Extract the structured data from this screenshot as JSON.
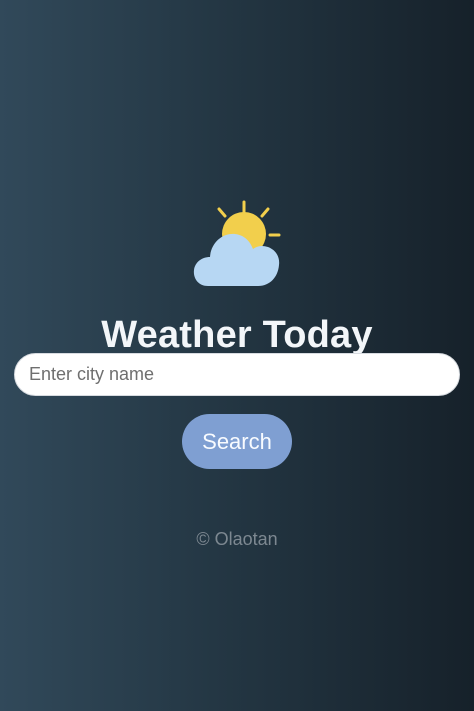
{
  "app": {
    "title": "Weather Today"
  },
  "search": {
    "placeholder": "Enter city name",
    "value": "",
    "button_label": "Search"
  },
  "footer": {
    "text": "© Olaotan"
  },
  "icons": {
    "weather": "partly-cloudy-icon"
  },
  "colors": {
    "background_start": "#31495a",
    "background_end": "#16212a",
    "sun": "#f2cf4c",
    "cloud": "#b7d7f3",
    "button": "#7f9fd2",
    "title": "#f3f6f9",
    "footer": "#7d8891"
  }
}
